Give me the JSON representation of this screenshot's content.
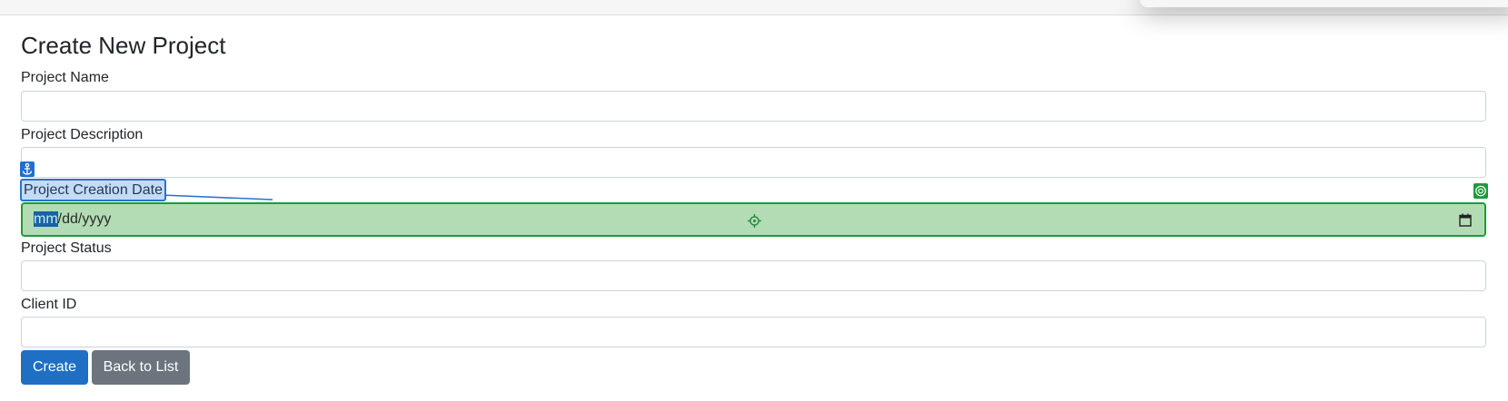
{
  "form": {
    "title": "Create New Project",
    "fields": [
      {
        "label": "Project Name",
        "value": ""
      },
      {
        "label": "Project Description",
        "value": ""
      },
      {
        "label": "Project Creation Date",
        "value": "",
        "placeholder_mm": "mm",
        "placeholder_rest": "/dd/yyyy"
      },
      {
        "label": "Project Status",
        "value": ""
      },
      {
        "label": "Client ID",
        "value": ""
      }
    ],
    "buttons": {
      "create": "Create",
      "back": "Back to List"
    }
  },
  "overlay": {
    "colors": {
      "anchor": "#1f6fd1",
      "target": "#1e9a3c",
      "target_fill": "#b3dcb5"
    },
    "icons": [
      "anchor-icon",
      "target-icon",
      "crosshair-icon",
      "calendar-icon"
    ]
  }
}
